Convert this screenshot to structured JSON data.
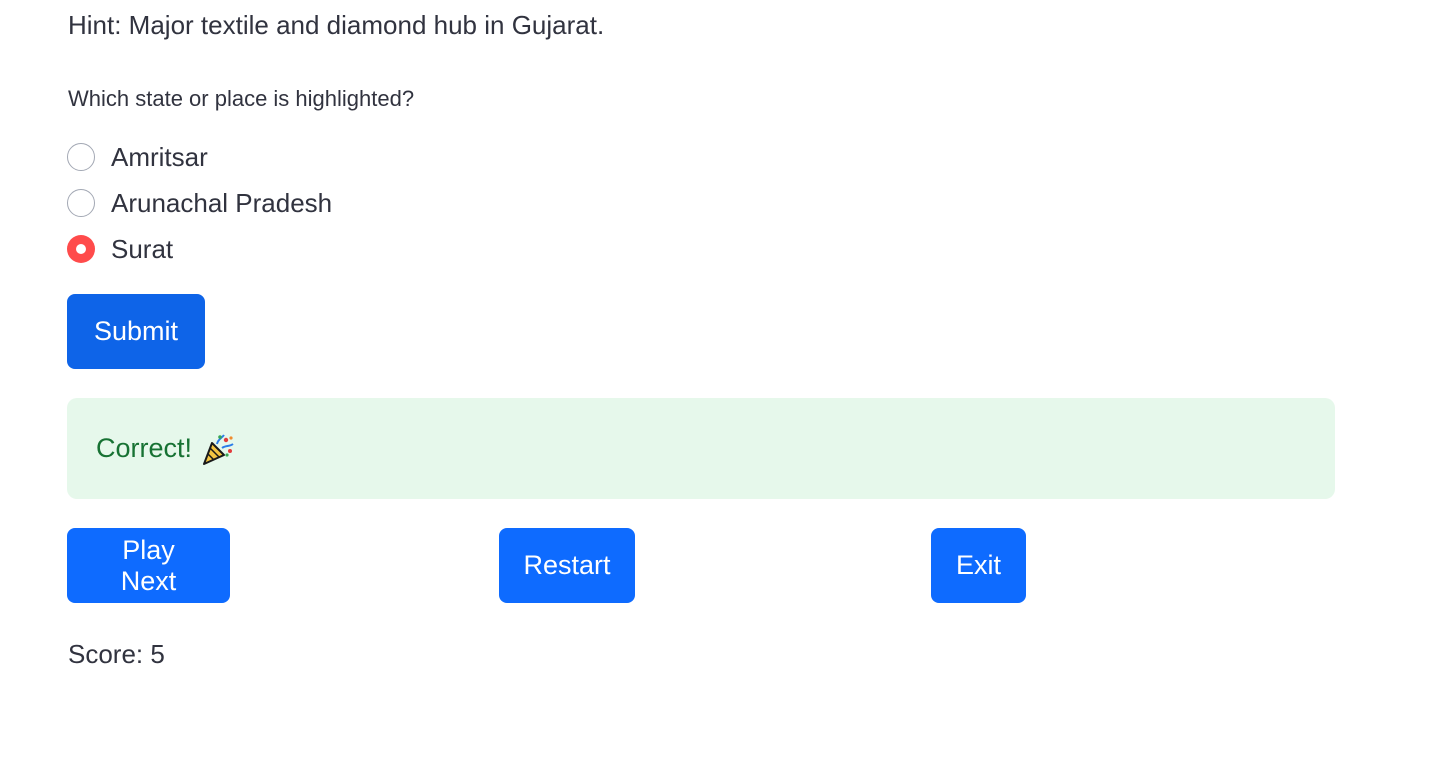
{
  "hint": "Hint: Major textile and diamond hub in Gujarat.",
  "question": "Which state or place is highlighted?",
  "options": [
    {
      "label": "Amritsar",
      "selected": false
    },
    {
      "label": "Arunachal Pradesh",
      "selected": false
    },
    {
      "label": "Surat",
      "selected": true
    }
  ],
  "submit_label": "Submit",
  "result": {
    "text": "Correct!",
    "icon": "party-popper-icon",
    "color": "#177233",
    "background": "#e6f8eb"
  },
  "actions": {
    "play_next": "Play Next",
    "restart": "Restart",
    "exit": "Exit"
  },
  "score_text": "Score: 5",
  "colors": {
    "radio_selected": "#ff4b4b",
    "button_primary": "#0e6bff"
  }
}
